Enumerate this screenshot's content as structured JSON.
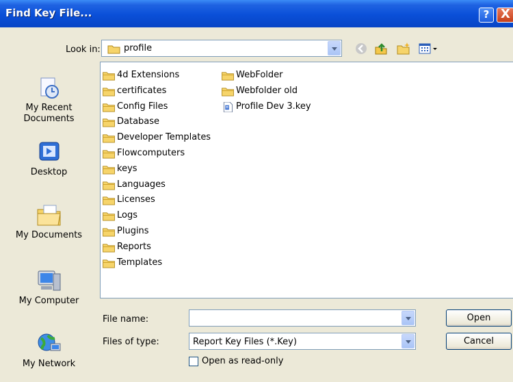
{
  "window": {
    "title": "Find Key File...",
    "help_label": "?",
    "close_label": "X"
  },
  "look_in": {
    "label": "Look in:",
    "value": "profile"
  },
  "toolbar": [
    "back-icon",
    "up-one-level-icon",
    "new-folder-icon",
    "views-menu-icon"
  ],
  "places": [
    {
      "label": "My Recent\nDocuments",
      "icon": "recent-documents-icon"
    },
    {
      "label": "Desktop",
      "icon": "desktop-icon"
    },
    {
      "label": "My Documents",
      "icon": "my-documents-icon"
    },
    {
      "label": "My Computer",
      "icon": "my-computer-icon"
    },
    {
      "label": "My Network",
      "icon": "my-network-icon"
    }
  ],
  "files": {
    "col1": [
      "4d Extensions",
      "certificates",
      "Config Files",
      "Database",
      "Developer Templates",
      "Flowcomputers",
      "keys",
      "Languages",
      "Licenses",
      "Logs",
      "Plugins",
      "Reports",
      "Templates"
    ],
    "col2": [
      "WebFolder",
      "Webfolder old"
    ],
    "key_file": "Profile Dev 3.key"
  },
  "form": {
    "file_name_label": "File name:",
    "file_name_value": "",
    "file_type_label": "Files of type:",
    "file_type_value": "Report Key Files (*.Key)",
    "readonly_label": "Open as read-only",
    "open_label": "Open",
    "cancel_label": "Cancel"
  }
}
